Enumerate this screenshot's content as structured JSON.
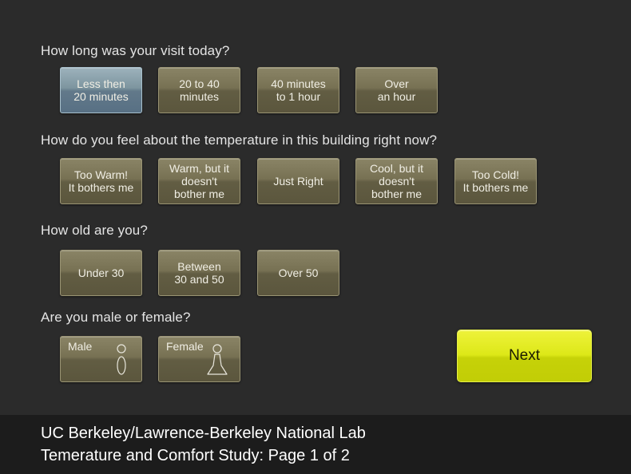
{
  "questions": {
    "visit_length": {
      "label": "How long was your visit today?",
      "options": [
        "Less then\n20 minutes",
        "20 to 40\nminutes",
        "40 minutes\nto 1 hour",
        "Over\nan hour"
      ],
      "selected": "Less then\n20 minutes"
    },
    "temperature": {
      "label": "How do you feel about the temperature in this building right now?",
      "options": [
        "Too Warm!\nIt bothers me",
        "Warm, but it\ndoesn't\nbother me",
        "Just Right",
        "Cool, but it\ndoesn't\nbother me",
        "Too Cold!\nIt bothers me"
      ]
    },
    "age": {
      "label": "How old are you?",
      "options": [
        "Under 30",
        "Between\n30 and 50",
        "Over 50"
      ]
    },
    "gender": {
      "label": "Are you male or female?",
      "options": [
        "Male",
        "Female"
      ],
      "icons": [
        "male-figure-icon",
        "female-figure-icon"
      ]
    }
  },
  "next_label": "Next",
  "footer": {
    "line1": "UC Berkeley/Lawrence-Berkeley National Lab",
    "line2": "Temerature and Comfort Study: Page 1 of 2"
  },
  "colors": {
    "background": "#2b2b2b",
    "option_button": "#777153",
    "selected_button": "#7d959f",
    "next_button": "#dde818",
    "footer": "#1c1c1c"
  }
}
